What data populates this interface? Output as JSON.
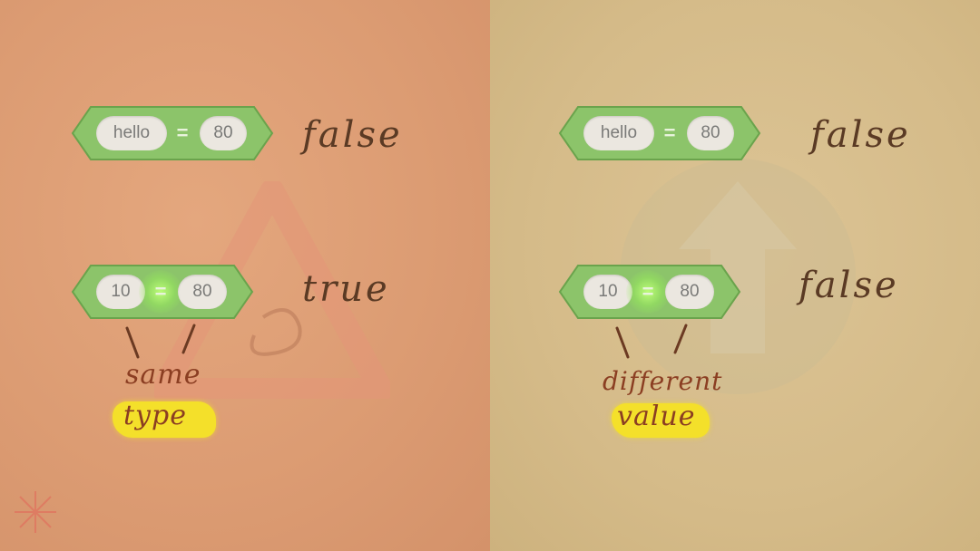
{
  "left": {
    "row1": {
      "left_value": "hello",
      "operator": "=",
      "right_value": "80",
      "result": "false"
    },
    "row2": {
      "left_value": "10",
      "operator": "=",
      "right_value": "80",
      "result": "true"
    },
    "note": {
      "line1": "same",
      "line2": "type"
    }
  },
  "right": {
    "row1": {
      "left_value": "hello",
      "operator": "=",
      "right_value": "80",
      "result": "false"
    },
    "row2": {
      "left_value": "10",
      "operator": "=",
      "right_value": "80",
      "result": "false"
    },
    "note": {
      "line1": "different",
      "line2": "value"
    }
  },
  "colors": {
    "left_bg": "#dc9c73",
    "right_bg": "#d5bb89",
    "block_green": "#8cc46a",
    "handwriting": "#5a3a24",
    "note_ink": "#8b3e22",
    "highlight": "#f4e02a"
  }
}
